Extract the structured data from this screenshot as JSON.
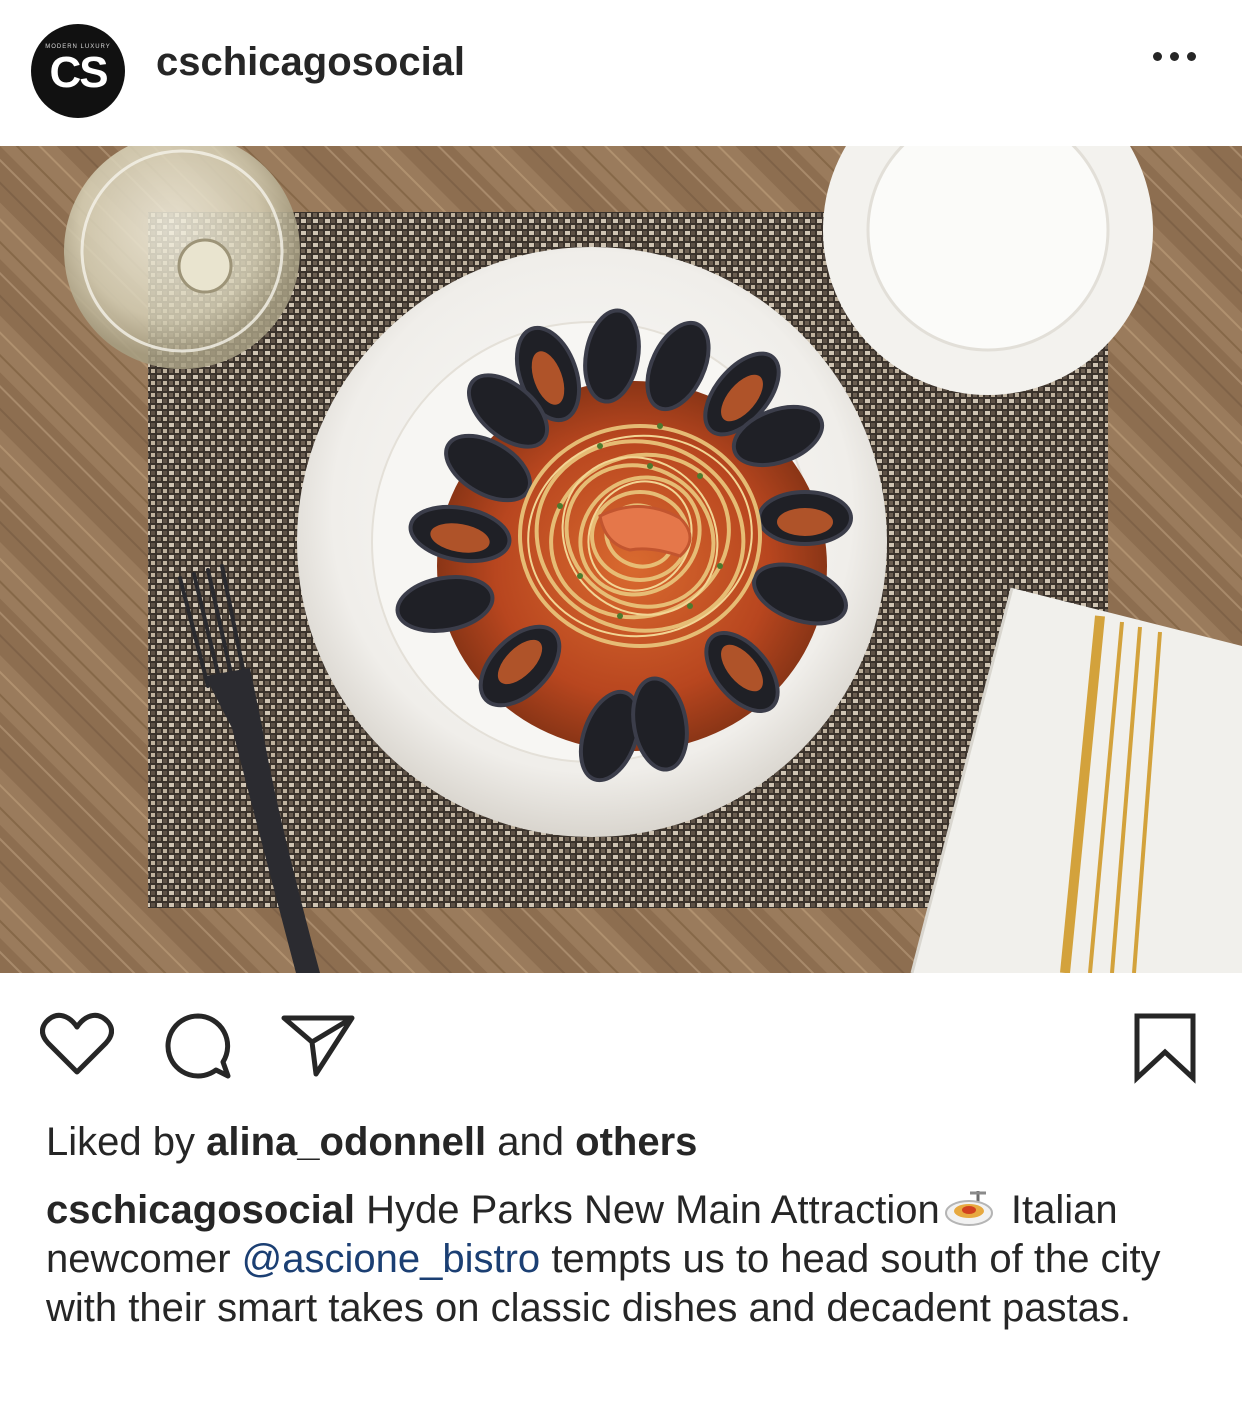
{
  "post": {
    "username": "cschicagosocial",
    "avatar_monogram": "CS",
    "avatar_tagline": "MODERN LUXURY",
    "more_icon": "more-horizontal-icon",
    "image_icon": "food-photo",
    "likes": {
      "prefix": "Liked by",
      "user": "alina_odonnell",
      "joiner": "and",
      "others": "others"
    },
    "caption": {
      "username": "cschicagosocial",
      "part1": "Hyde Parks New Main Attraction",
      "emoji": "spaghetti-emoji",
      "part2": "Italian newcomer",
      "mention": "@ascione_bistro",
      "part3": "tempts us to head south of the city with their smart takes on classic dishes and decadent pastas."
    },
    "actions": {
      "like_icon": "heart-icon",
      "comment_icon": "comment-icon",
      "share_icon": "paper-plane-icon",
      "save_icon": "bookmark-icon"
    }
  }
}
